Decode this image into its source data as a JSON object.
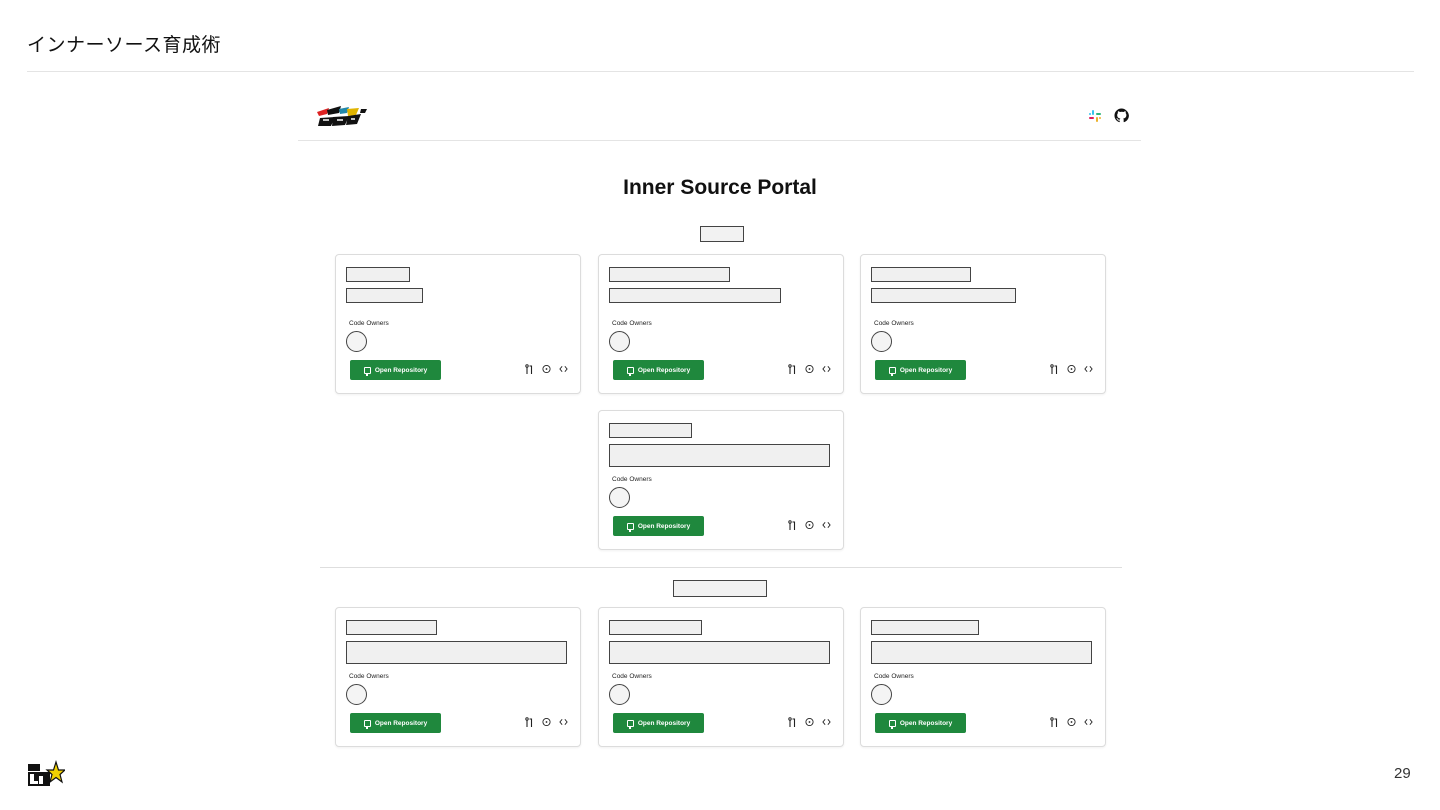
{
  "slide": {
    "title": "インナーソース育成術",
    "page_number": "29"
  },
  "portal": {
    "title": "Inner Source Portal",
    "header_icons": [
      "slack-icon",
      "github-icon"
    ]
  },
  "card_labels": {
    "code_owners": "Code Owners",
    "open_repository": "Open Repository"
  },
  "colors": {
    "button_green": "#1f883d",
    "placeholder_border": "#444444",
    "card_border": "#dcdcdc"
  },
  "stat_icons": [
    "pull-request-icon",
    "issue-icon",
    "code-icon"
  ]
}
